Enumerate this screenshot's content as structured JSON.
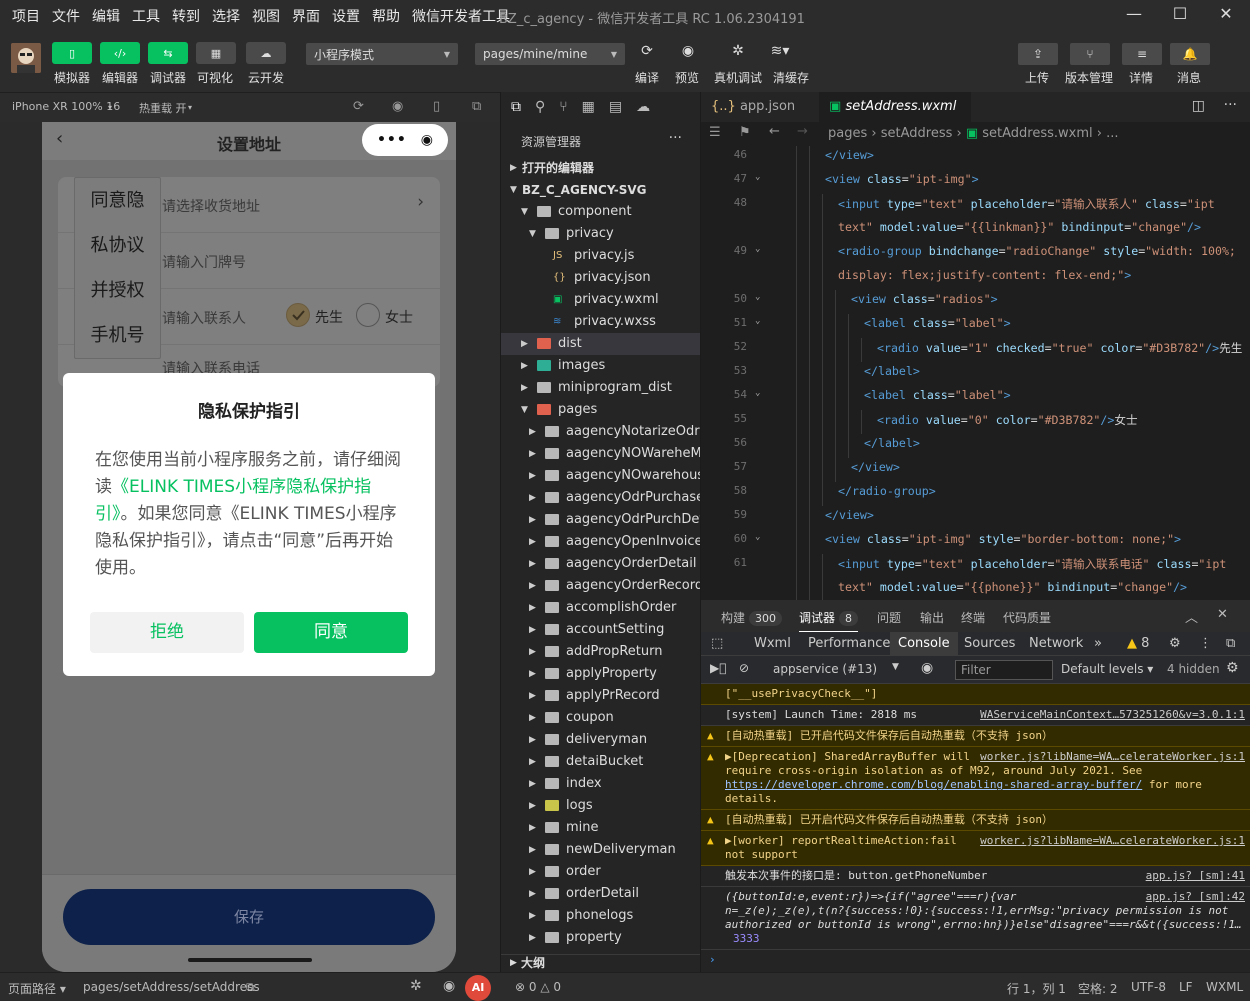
{
  "menu": [
    "项目",
    "文件",
    "编辑",
    "工具",
    "转到",
    "选择",
    "视图",
    "界面",
    "设置",
    "帮助",
    "微信开发者工具"
  ],
  "window_title": "BZ_c_agency - 微信开发者工具 RC 1.06.2304191",
  "toolbar": {
    "left_buttons": [
      {
        "icon": "phone-icon",
        "label": "模拟器"
      },
      {
        "icon": "code-icon",
        "label": "编辑器"
      },
      {
        "icon": "debug-icon",
        "label": "调试器"
      },
      {
        "icon": "visual-icon",
        "label": "可视化"
      },
      {
        "icon": "cloud-icon",
        "label": "云开发"
      }
    ],
    "mode_select": "小程序模式",
    "page_select": "pages/mine/mine",
    "mid_buttons": [
      {
        "icon": "refresh-icon",
        "label": "编译"
      },
      {
        "icon": "eye-icon",
        "label": "预览"
      },
      {
        "icon": "bug-icon",
        "label": "真机调试"
      },
      {
        "icon": "layers-icon",
        "label": "清缓存"
      }
    ],
    "right_buttons": [
      {
        "icon": "upload-icon",
        "label": "上传"
      },
      {
        "icon": "branch-icon",
        "label": "版本管理"
      },
      {
        "icon": "menu-icon",
        "label": "详情"
      },
      {
        "icon": "bell-icon",
        "label": "消息"
      }
    ]
  },
  "simbar": {
    "device": "iPhone XR 100% 16",
    "hot_reload": "热重载 开"
  },
  "phone": {
    "nav_title": "设置地址",
    "fields": [
      {
        "placeholder": "请选择收货地址"
      },
      {
        "placeholder": "请输入门牌号"
      },
      {
        "placeholder": "请输入联系人"
      },
      {
        "placeholder": "请输入联系电话"
      }
    ],
    "radio_male": "先生",
    "radio_female": "女士",
    "popover": [
      "同意隐",
      "私协议",
      "并授权",
      "手机号"
    ],
    "dialog": {
      "title": "隐私保护指引",
      "text_before": "在您使用当前小程序服务之前，请仔细阅读",
      "link": "《ELINK TIMES小程序隐私保护指引》",
      "text_after": "。如果您同意《ELINK TIMES小程序隐私保护指引》，请点击“同意”后再开始使用。",
      "reject": "拒绝",
      "agree": "同意"
    },
    "save": "保存"
  },
  "explorer": {
    "title": "资源管理器",
    "open_editors": "打开的编辑器",
    "project": "BZ_C_AGENCY-SVG",
    "outline": "大纲",
    "tree": [
      {
        "name": "component",
        "depth": 1,
        "type": "folder",
        "open": true
      },
      {
        "name": "privacy",
        "depth": 2,
        "type": "folder",
        "open": true
      },
      {
        "name": "privacy.js",
        "depth": 3,
        "type": "js"
      },
      {
        "name": "privacy.json",
        "depth": 3,
        "type": "json"
      },
      {
        "name": "privacy.wxml",
        "depth": 3,
        "type": "wxml"
      },
      {
        "name": "privacy.wxss",
        "depth": 3,
        "type": "wxss"
      },
      {
        "name": "dist",
        "depth": 1,
        "type": "folder-red",
        "open": false,
        "selected": true
      },
      {
        "name": "images",
        "depth": 1,
        "type": "folder-teal",
        "open": false
      },
      {
        "name": "miniprogram_dist",
        "depth": 1,
        "type": "folder",
        "open": false
      },
      {
        "name": "pages",
        "depth": 1,
        "type": "folder-red",
        "open": true
      },
      {
        "name": "aagencyNotarizeOdr",
        "depth": 2,
        "type": "folder",
        "open": false
      },
      {
        "name": "aagencyNOWarehеMana",
        "depth": 2,
        "type": "folder",
        "open": false
      },
      {
        "name": "aagencyNOwarehouse",
        "depth": 2,
        "type": "folder",
        "open": false
      },
      {
        "name": "aagencyOdrPurchase",
        "depth": 2,
        "type": "folder",
        "open": false
      },
      {
        "name": "aagencyOdrPurchDet",
        "depth": 2,
        "type": "folder",
        "open": false
      },
      {
        "name": "aagencyOpenInvoice",
        "depth": 2,
        "type": "folder",
        "open": false
      },
      {
        "name": "aagencyOrderDetail",
        "depth": 2,
        "type": "folder",
        "open": false
      },
      {
        "name": "aagencyOrderRecord",
        "depth": 2,
        "type": "folder",
        "open": false
      },
      {
        "name": "accomplishOrder",
        "depth": 2,
        "type": "folder",
        "open": false
      },
      {
        "name": "accountSetting",
        "depth": 2,
        "type": "folder",
        "open": false
      },
      {
        "name": "addPropReturn",
        "depth": 2,
        "type": "folder",
        "open": false
      },
      {
        "name": "applyProperty",
        "depth": 2,
        "type": "folder",
        "open": false
      },
      {
        "name": "applyPrRecord",
        "depth": 2,
        "type": "folder",
        "open": false
      },
      {
        "name": "coupon",
        "depth": 2,
        "type": "folder",
        "open": false
      },
      {
        "name": "deliveryman",
        "depth": 2,
        "type": "folder",
        "open": false
      },
      {
        "name": "detaiBucket",
        "depth": 2,
        "type": "folder",
        "open": false
      },
      {
        "name": "index",
        "depth": 2,
        "type": "folder",
        "open": false
      },
      {
        "name": "logs",
        "depth": 2,
        "type": "folder-yellow",
        "open": false
      },
      {
        "name": "mine",
        "depth": 2,
        "type": "folder",
        "open": false
      },
      {
        "name": "newDeliveryman",
        "depth": 2,
        "type": "folder",
        "open": false
      },
      {
        "name": "order",
        "depth": 2,
        "type": "folder",
        "open": false
      },
      {
        "name": "orderDetail",
        "depth": 2,
        "type": "folder",
        "open": false
      },
      {
        "name": "phonelogs",
        "depth": 2,
        "type": "folder",
        "open": false
      },
      {
        "name": "property",
        "depth": 2,
        "type": "folder",
        "open": false
      }
    ]
  },
  "editor": {
    "tabs": [
      "app.json",
      "setAddress.wxml"
    ],
    "breadcrumb": [
      "pages",
      "setAddress",
      "setAddress.wxml",
      "..."
    ],
    "lines": [
      {
        "n": "46",
        "indent": 9,
        "html": "<span class='tag'>&lt;/view&gt;</span>"
      },
      {
        "n": "47",
        "indent": 9,
        "fold": true,
        "html": "<span class='tag'>&lt;view</span> <span class='att'>class</span>=<span class='str'>\"ipt-img\"</span><span class='tag'>&gt;</span>"
      },
      {
        "n": "48",
        "indent": 10,
        "html": "<span class='tag'>&lt;input</span> <span class='att'>type</span>=<span class='str'>\"text\"</span> <span class='att'>placeholder</span>=<span class='str'>\"请输入联系人\"</span> <span class='att'>class</span>=<span class='str'>\"ipt</span>"
      },
      {
        "n": "",
        "indent": 10,
        "html": "<span class='str'>text\"</span> <span class='att'>model:value</span>=<span class='str'>\"{{linkman}}\"</span> <span class='att'>bindinput</span>=<span class='str'>\"change\"</span><span class='tag'>/&gt;</span>"
      },
      {
        "n": "49",
        "indent": 10,
        "fold": true,
        "html": "<span class='tag'>&lt;radio-group</span> <span class='att'>bindchange</span>=<span class='str'>\"radioChange\"</span> <span class='att'>style</span>=<span class='str'>\"width: 100%;</span>"
      },
      {
        "n": "",
        "indent": 10,
        "html": "<span class='str'>display: flex;justify-content: flex-end;\"</span><span class='tag'>&gt;</span>"
      },
      {
        "n": "50",
        "indent": 11,
        "fold": true,
        "html": "<span class='tag'>&lt;view</span> <span class='att'>class</span>=<span class='str'>\"radios\"</span><span class='tag'>&gt;</span>"
      },
      {
        "n": "51",
        "indent": 12,
        "fold": true,
        "html": "<span class='tag'>&lt;label</span> <span class='att'>class</span>=<span class='str'>\"label\"</span><span class='tag'>&gt;</span>"
      },
      {
        "n": "52",
        "indent": 13,
        "html": "<span class='tag'>&lt;radio</span> <span class='att'>value</span>=<span class='str'>\"1\"</span> <span class='att'>checked</span>=<span class='str'>\"true\"</span> <span class='att'>color</span>=<span class='str'>\"#D3B782\"</span><span class='tag'>/&gt;</span>先生"
      },
      {
        "n": "53",
        "indent": 12,
        "html": "<span class='tag'>&lt;/label&gt;</span>"
      },
      {
        "n": "54",
        "indent": 12,
        "fold": true,
        "html": "<span class='tag'>&lt;label</span> <span class='att'>class</span>=<span class='str'>\"label\"</span><span class='tag'>&gt;</span>"
      },
      {
        "n": "55",
        "indent": 13,
        "html": "<span class='tag'>&lt;radio</span> <span class='att'>value</span>=<span class='str'>\"0\"</span> <span class='att'>color</span>=<span class='str'>\"#D3B782\"</span><span class='tag'>/&gt;</span>女士"
      },
      {
        "n": "56",
        "indent": 12,
        "html": "<span class='tag'>&lt;/label&gt;</span>"
      },
      {
        "n": "57",
        "indent": 11,
        "html": "<span class='tag'>&lt;/view&gt;</span>"
      },
      {
        "n": "58",
        "indent": 10,
        "html": "<span class='tag'>&lt;/radio-group&gt;</span>"
      },
      {
        "n": "59",
        "indent": 9,
        "html": "<span class='tag'>&lt;/view&gt;</span>"
      },
      {
        "n": "60",
        "indent": 9,
        "fold": true,
        "html": "<span class='tag'>&lt;view</span> <span class='att'>class</span>=<span class='str'>\"ipt-img\"</span> <span class='att'>style</span>=<span class='str'>\"border-bottom: none;\"</span><span class='tag'>&gt;</span>"
      },
      {
        "n": "61",
        "indent": 10,
        "html": "<span class='tag'>&lt;input</span> <span class='att'>type</span>=<span class='str'>\"text\"</span> <span class='att'>placeholder</span>=<span class='str'>\"请输入联系电话\"</span> <span class='att'>class</span>=<span class='str'>\"ipt</span>"
      },
      {
        "n": "",
        "indent": 10,
        "html": "<span class='str'>text\"</span> <span class='att'>model:value</span>=<span class='str'>\"{{phone}}\"</span> <span class='att'>bindinput</span>=<span class='str'>\"change\"</span><span class='tag'>/&gt;</span>"
      }
    ]
  },
  "devtools": {
    "top_tabs": [
      {
        "label": "构建",
        "badge": "300"
      },
      {
        "label": "调试器",
        "badge": "8"
      },
      {
        "label": "问题"
      },
      {
        "label": "输出"
      },
      {
        "label": "终端"
      },
      {
        "label": "代码质量"
      }
    ],
    "panel_tabs": [
      "Wxml",
      "Performance",
      "Console",
      "Sources",
      "Network"
    ],
    "warn_count": "8",
    "context": "appservice (#13)",
    "filter_placeholder": "Filter",
    "levels": "Default levels",
    "hidden": "4 hidden",
    "logs": [
      {
        "type": "warn",
        "text": "[\"__usePrivacyCheck__\"]"
      },
      {
        "type": "info",
        "text": "[system] Launch Time: 2818 ms",
        "src": "WAServiceMainContext…573251260&v=3.0.1:1"
      },
      {
        "type": "warn",
        "text": "[自动热重载] 已开启代码文件保存后自动热重载（不支持 json）"
      },
      {
        "type": "warn",
        "text": "▶[Deprecation] SharedArrayBuffer will require cross-origin isolation as of M92, around July 2021. See ",
        "url": "https://developer.chrome.com/blog/enabling-shared-array-buffer/",
        "after": " for more details.",
        "src": "worker.js?libName=WA…celerateWorker.js:1"
      },
      {
        "type": "warn",
        "text": "[自动热重载] 已开启代码文件保存后自动热重载（不支持 json）"
      },
      {
        "type": "warn",
        "text": "▶[worker] reportRealtimeAction:fail not support",
        "src": "worker.js?libName=WA…celerateWorker.js:1"
      },
      {
        "type": "info",
        "text": "触发本次事件的接口是: button.getPhoneNumber",
        "src": "app.js? [sm]:41"
      },
      {
        "type": "info",
        "italic": true,
        "text": "({buttonId:e,event:r})=>{if(\"agree\"===r){var n=_z(e);_z(e),t(n?{success:!0}:{success:!1,errMsg:\"privacy permission is not authorized or buttonId is wrong\",errno:hn})}else\"disagree\"===r&&t({success:!1…",
        "tail": "3333",
        "src": "app.js? [sm]:42"
      }
    ]
  },
  "statusbar": {
    "page_path_label": "页面路径",
    "page_path": "pages/setAddress/setAddress",
    "errors": "0",
    "warnings": "0",
    "position": "行 1，列 1",
    "spaces": "空格: 2",
    "encoding": "UTF-8",
    "eol": "LF",
    "lang": "WXML",
    "ai": "AI"
  },
  "colors": {
    "brand": "#07c160",
    "radio_checked": "#D3B782",
    "save_btn": "#0d214a"
  }
}
